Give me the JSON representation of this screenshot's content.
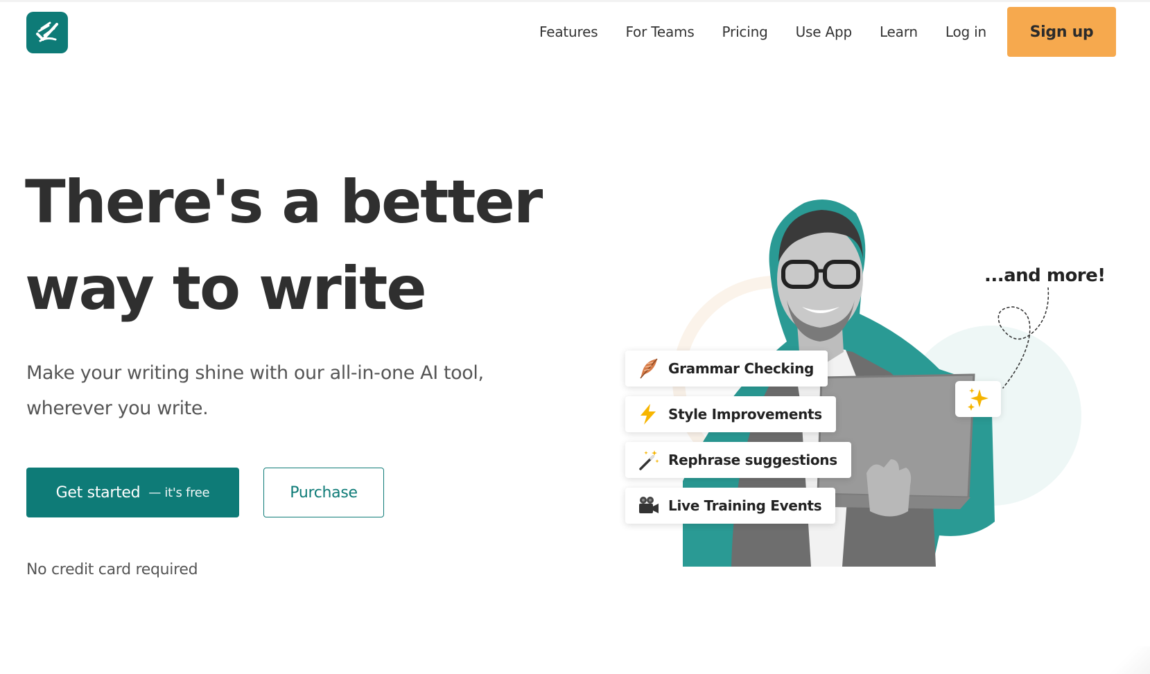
{
  "brand": {
    "logo_icon": "checkmark-pen-logo-icon",
    "color": "#0e7b77"
  },
  "nav": {
    "links": [
      "Features",
      "For Teams",
      "Pricing",
      "Use App",
      "Learn",
      "Log in"
    ],
    "signup_label": "Sign up",
    "signup_color": "#f6a94e"
  },
  "hero": {
    "headline_line1": "There's a better",
    "headline_line2": "way to write",
    "subhead_line1": "Make your writing shine with our all-in-one AI tool,",
    "subhead_line2": "wherever you write.",
    "primary_cta_main": "Get started",
    "primary_cta_sub": "— it's free",
    "secondary_cta": "Purchase",
    "note": "No credit card required"
  },
  "illustration": {
    "and_more": "...and more!",
    "sparkle_icon": "sparkles-icon",
    "features": [
      {
        "label": "Grammar Checking",
        "icon": "feather-icon"
      },
      {
        "label": "Style Improvements",
        "icon": "lightning-icon"
      },
      {
        "label": "Rephrase suggestions",
        "icon": "magic-wand-icon"
      },
      {
        "label": "Live Training Events",
        "icon": "video-camera-icon"
      }
    ]
  }
}
